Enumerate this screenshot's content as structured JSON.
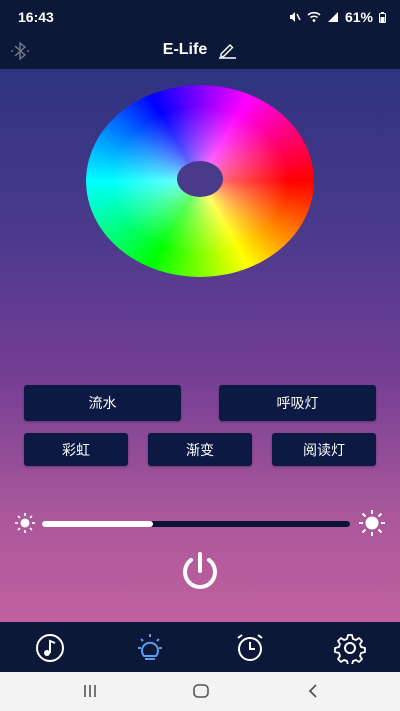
{
  "status_bar": {
    "time": "16:43",
    "battery": "61%",
    "icons": [
      "mute-icon",
      "wifi-icon",
      "signal-icon",
      "battery-icon"
    ]
  },
  "header": {
    "title": "E-Life",
    "left_icon": "bluetooth-icon",
    "edit_icon": "pencil-icon"
  },
  "color_wheel": {
    "icon": "color-wheel"
  },
  "modes": [
    {
      "label": "流水"
    },
    {
      "label": "呼吸灯"
    },
    {
      "label": "彩虹"
    },
    {
      "label": "渐变"
    },
    {
      "label": "阅读灯"
    }
  ],
  "brightness": {
    "value": 0.36,
    "min_icon": "sun-small-icon",
    "max_icon": "sun-large-icon"
  },
  "power_icon": "power-icon",
  "bottom_nav": [
    {
      "icon": "music-icon",
      "active": false
    },
    {
      "icon": "light-bulb-icon",
      "active": true
    },
    {
      "icon": "alarm-clock-icon",
      "active": false
    },
    {
      "icon": "settings-gear-icon",
      "active": false
    }
  ],
  "system_nav": [
    "recent-apps-icon",
    "home-icon",
    "back-icon"
  ],
  "colors": {
    "bar_bg": "#0c1838",
    "button_bg": "#0c1942",
    "active_nav": "#5a9cf0"
  }
}
